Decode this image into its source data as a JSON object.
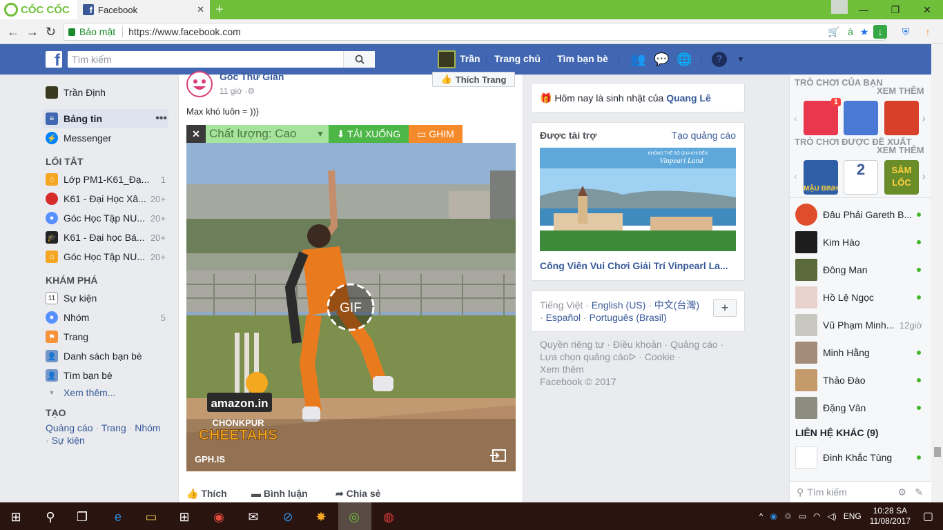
{
  "browser": {
    "brand": "CỐC CỐC",
    "tab_title": "Facebook",
    "security_label": "Bảo mật",
    "url": "https://www.facebook.com"
  },
  "fb_header": {
    "search_placeholder": "Tìm kiếm",
    "user_name": "Trần",
    "home": "Trang chủ",
    "find_friends": "Tìm bạn bè"
  },
  "left_nav": {
    "profile": "Trần Định",
    "news_feed": "Bảng tin",
    "messenger": "Messenger",
    "shortcuts_heading": "LỐI TẮT",
    "shortcuts": [
      {
        "label": "Lớp PM1-K61_Đạ...",
        "count": "1"
      },
      {
        "label": "K61 - Đại Học Xâ...",
        "count": "20+"
      },
      {
        "label": "Góc Học Tập NU...",
        "count": "20+"
      },
      {
        "label": "K61 - Đại học Bá...",
        "count": "20+"
      },
      {
        "label": "Góc Học Tập NU...",
        "count": "20+"
      }
    ],
    "explore_heading": "KHÁM PHÁ",
    "explore": [
      {
        "label": "Sự kiện",
        "count": "",
        "icon": "11"
      },
      {
        "label": "Nhóm",
        "count": "5"
      },
      {
        "label": "Trang",
        "count": ""
      },
      {
        "label": "Danh sách bạn bè",
        "count": ""
      },
      {
        "label": "Tìm bạn bè",
        "count": ""
      }
    ],
    "see_more": "Xem thêm...",
    "create_heading": "TẠO",
    "create_links": [
      "Quảng cáo",
      "Trang",
      "Nhóm",
      "Sự kiện"
    ]
  },
  "post": {
    "page_name": "Góc Thư Giãn",
    "time": "11 giờ",
    "like_page": "Thích Trang",
    "text": "Max khó luôn = )))",
    "gif_toolbar": {
      "close": "✕",
      "quality": "Chất lượng: Cao",
      "download": "TẢI XUỐNG",
      "pin": "GHIM"
    },
    "gif_label": "GIF",
    "gif_source": "GPH.IS",
    "team_sponsor": "amazon.in",
    "team_name1": "CHONKPUR",
    "team_name2": "CHEETAHS",
    "actions": {
      "like": "Thích",
      "comment": "Bình luận",
      "share": "Chia sẻ"
    }
  },
  "right_col": {
    "birthday_prefix": "Hôm nay là sinh nhật của ",
    "birthday_name": "Quang Lê",
    "sponsored": "Được tài trợ",
    "create_ad": "Tạo quảng cáo",
    "ad_title": "Công Viên Vui Chơi Giải Trí Vinpearl La...",
    "ad_banner": "Vinpearl Land",
    "ad_banner_sub": "KHÔNG THỂ BỎ QUA KHI ĐẾN",
    "languages_line1": [
      "Tiếng Việt",
      "English (US)",
      "中文(台灣)"
    ],
    "languages_line2": [
      "Español",
      "Português (Brasil)"
    ],
    "plus": "+",
    "footer_line1": [
      "Quyền riêng tư",
      "Điều khoản",
      "Quảng cáo"
    ],
    "footer_line2": [
      "Lựa chọn quảng cáo",
      "Cookie"
    ],
    "footer_more": "Xem thêm",
    "copyright": "Facebook © 2017"
  },
  "chat": {
    "games_heading": "TRÒ CHƠI CỦA BẠN",
    "see_more": "XEM THÊM",
    "suggested_heading": "TRÒ CHƠI ĐƯỢC ĐỀ XUẤT",
    "see_more2": "XEM THÊM",
    "game_badge": "1",
    "game_tile_labels": [
      "MẬU BINH",
      "2",
      "SÂM LỐC"
    ],
    "contacts": [
      {
        "name": "Đâu Phải Gareth B...",
        "status": "online"
      },
      {
        "name": "Kim Hào",
        "status": "online"
      },
      {
        "name": "Đông Man",
        "status": "online"
      },
      {
        "name": "Hồ Lệ Ngọc",
        "status": "online"
      },
      {
        "name": "Vũ Phạm Minh...",
        "status": "12giờ"
      },
      {
        "name": "Minh Hằng",
        "status": "online"
      },
      {
        "name": "Thảo Đào",
        "status": "online"
      },
      {
        "name": "Đặng Vân",
        "status": "online"
      }
    ],
    "other_contacts_heading": "LIÊN HỆ KHÁC (9)",
    "other_contact": "Đinh Khắc Tùng",
    "search_placeholder": "Tìm kiếm"
  },
  "taskbar": {
    "lang": "ENG",
    "time": "10:28 SA",
    "date": "11/08/2017"
  }
}
